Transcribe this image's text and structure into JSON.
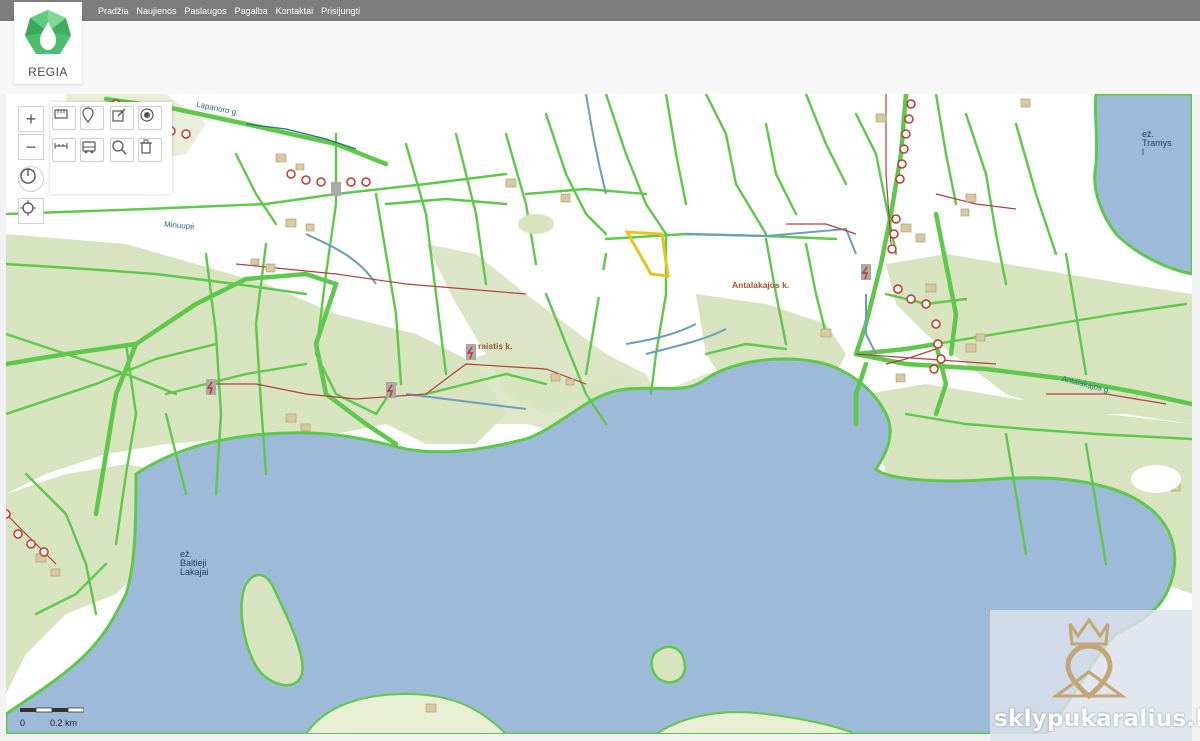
{
  "nav": {
    "items": [
      "Pradžia",
      "Naujienos",
      "Paslaugos",
      "Pagalba",
      "Kontaktai",
      "Prisijungti"
    ]
  },
  "logo": {
    "text": "REGIA"
  },
  "map": {
    "labels": {
      "lake_tramys": [
        "ež.",
        "Tramys",
        "l"
      ],
      "lake_baltieji": [
        "ež.",
        "Baltieji",
        "Lakajai"
      ],
      "village_antalakajos": "Antalakajos k.",
      "village_paraistis": "raistis k.",
      "road_minuupe": "Minuupė",
      "road_lapanoro": "Lapanoro g.",
      "road_north_east": "Antalakajos g."
    },
    "scale": {
      "zero": "0",
      "distance": "0.2 km"
    }
  },
  "watermark": {
    "text": "sklypukaralius.lt"
  },
  "colors": {
    "water": "#9dbbd8",
    "forest": "#d8e3c0",
    "parcel_line": "#5ec84a",
    "highlight": "#e8c21e",
    "power_line": "#b04040"
  },
  "toolbar": {
    "zoom_in": "+",
    "zoom_out": "−",
    "icons": [
      "measure-area-icon",
      "pin-icon",
      "edit-icon",
      "target-icon",
      "measure-line-icon",
      "bus-icon",
      "search-map-icon",
      "trash-icon"
    ]
  }
}
